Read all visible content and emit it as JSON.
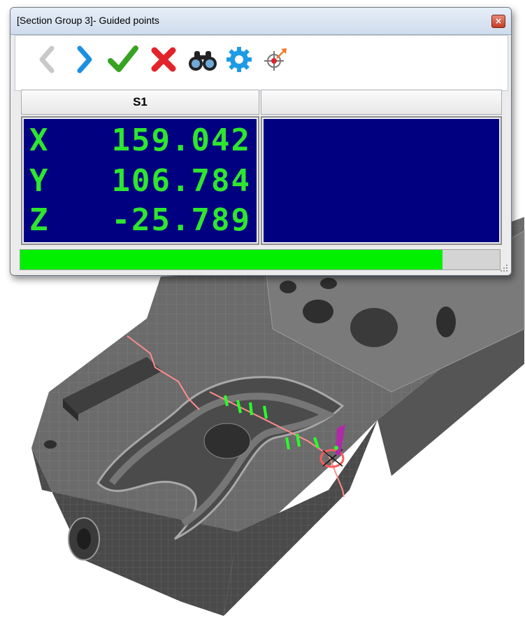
{
  "window": {
    "title": "[Section Group 3]- Guided points",
    "close_glyph": "×"
  },
  "toolbar": {
    "buttons": [
      {
        "name": "previous",
        "icon": "chevron-left-icon",
        "enabled": false
      },
      {
        "name": "next",
        "icon": "chevron-right-icon",
        "enabled": true
      },
      {
        "name": "accept",
        "icon": "checkmark-icon",
        "enabled": true
      },
      {
        "name": "cancel",
        "icon": "x-icon",
        "enabled": true
      },
      {
        "name": "find",
        "icon": "binoculars-icon",
        "enabled": true
      },
      {
        "name": "settings",
        "icon": "gear-icon",
        "enabled": true
      },
      {
        "name": "target",
        "icon": "crosshair-arrow-icon",
        "enabled": true
      }
    ]
  },
  "grid": {
    "columns": [
      {
        "header": "S1"
      },
      {
        "header": ""
      }
    ],
    "s1": {
      "x_label": "X",
      "x_value": "159.042",
      "y_label": "Y",
      "y_value": "106.784",
      "z_label": "Z",
      "z_value": "-25.789"
    }
  },
  "progress": {
    "fraction": 0.88
  },
  "colors": {
    "readout_bg": "#000080",
    "readout_text": "#2ee62e",
    "progress_fill": "#00f000",
    "model_gray": "#6d6d6d"
  }
}
